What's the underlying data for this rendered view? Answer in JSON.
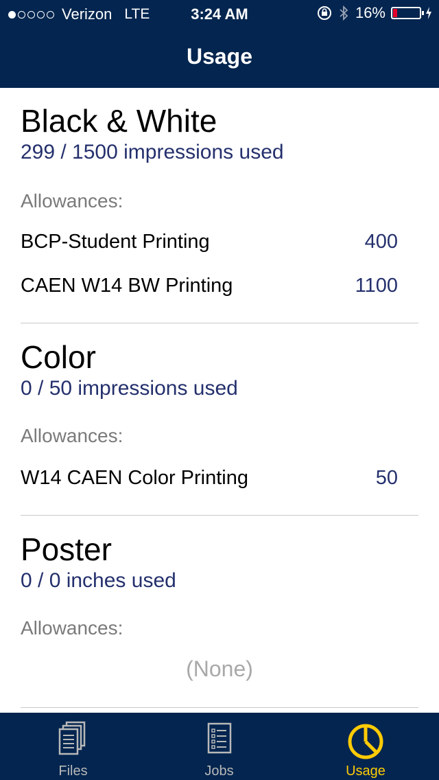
{
  "status_bar": {
    "carrier": "Verizon",
    "network": "LTE",
    "time": "3:24 AM",
    "battery": "16%",
    "battery_level": 0.16
  },
  "header": {
    "title": "Usage"
  },
  "sections": [
    {
      "title": "Black & White",
      "used": "299 / 1500 impressions used",
      "allowances_label": "Allowances:",
      "allowances": [
        {
          "name": "BCP-Student Printing",
          "value": "400"
        },
        {
          "name": "CAEN W14 BW Printing",
          "value": "1100"
        }
      ]
    },
    {
      "title": "Color",
      "used": "0 / 50 impressions used",
      "allowances_label": "Allowances:",
      "allowances": [
        {
          "name": "W14 CAEN Color Printing",
          "value": "50"
        }
      ]
    },
    {
      "title": "Poster",
      "used": "0 / 0 inches used",
      "allowances_label": "Allowances:",
      "none_text": "(None)"
    }
  ],
  "tabs": [
    {
      "label": "Files",
      "icon": "files-icon"
    },
    {
      "label": "Jobs",
      "icon": "jobs-icon"
    },
    {
      "label": "Usage",
      "icon": "usage-icon",
      "active": true
    }
  ],
  "colors": {
    "nav_bg": "#03254f",
    "accent": "#ffcb05",
    "value_text": "#24306d"
  }
}
